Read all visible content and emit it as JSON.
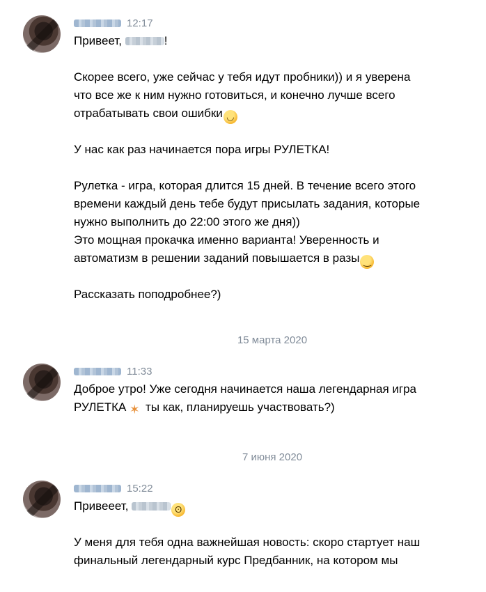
{
  "messages": [
    {
      "time": "12:17",
      "greeting_prefix": "Привеет, ",
      "greeting_suffix": "!",
      "p1": "Скорее всего, уже сейчас у тебя идут пробники)) и я уверена",
      "p2": "что все же к ним нужно готовиться, и конечно лучше всего",
      "p3": "отрабатывать свои ошибки",
      "p4": "У нас как раз начинается пора игры РУЛЕТКА!",
      "p5": "Рулетка - игра, которая длится 15 дней. В течение всего этого",
      "p6": "времени каждый день тебе будут присылать задания, которые",
      "p7": "нужно выполнить до 22:00 этого же дня))",
      "p8": "Это мощная прокачка именно варианта! Уверенность и",
      "p9": "автоматизм в решении заданий повышается в разы",
      "p10": "Рассказать поподробнее?)"
    },
    {
      "time": "11:33",
      "p1": "Доброе утро! Уже сегодня начинается наша легендарная игра",
      "p2a": "РУЛЕТКА",
      "p2b": " ты как, планируешь участвовать?)"
    },
    {
      "time": "15:22",
      "greeting_prefix": "Привееет, ",
      "p1": "У меня для тебя одна важнейшая новость: скоро стартует наш",
      "p2": "финальный легендарный курс Предбанник, на котором мы"
    }
  ],
  "dates": [
    "15 марта 2020",
    "7 июня 2020"
  ],
  "icons": {
    "smile": "smiling-face-emoji",
    "wink": "winking-face-emoji",
    "party": "party-popper-emoji",
    "flushed": "flushed-face-emoji"
  }
}
